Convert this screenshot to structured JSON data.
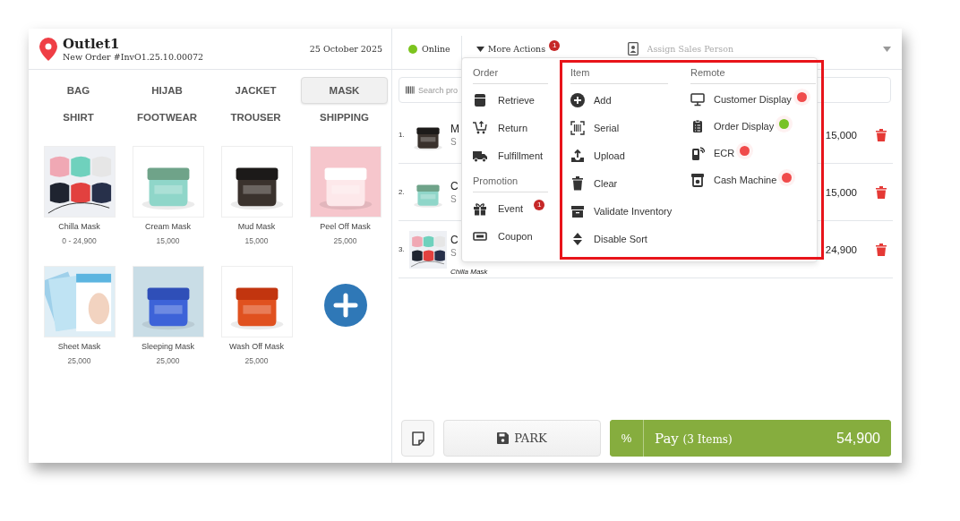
{
  "header": {
    "outlet": "Outlet1",
    "order_number": "New Order #InvO1.25.10.00072",
    "date": "25 October 2025"
  },
  "categories": [
    {
      "label": "BAG",
      "selected": false
    },
    {
      "label": "HIJAB",
      "selected": false
    },
    {
      "label": "JACKET",
      "selected": false
    },
    {
      "label": "MASK",
      "selected": true
    },
    {
      "label": "SHIRT",
      "selected": false
    },
    {
      "label": "FOOTWEAR",
      "selected": false
    },
    {
      "label": "TROUSER",
      "selected": false
    },
    {
      "label": "SHIPPING",
      "selected": false
    }
  ],
  "products": [
    {
      "name": "Chilla Mask",
      "price": "0 - 24,900"
    },
    {
      "name": "Cream Mask",
      "price": "15,000"
    },
    {
      "name": "Mud Mask",
      "price": "15,000"
    },
    {
      "name": "Peel Off Mask",
      "price": "25,000"
    },
    {
      "name": "Sheet Mask",
      "price": "25,000"
    },
    {
      "name": "Sleeping Mask",
      "price": "25,000"
    },
    {
      "name": "Wash Off Mask",
      "price": "25,000"
    }
  ],
  "toolbar": {
    "online": true,
    "status_label": "Online",
    "more_actions": "More Actions",
    "more_actions_badge": "1",
    "sales_person_placeholder": "Assign Sales Person"
  },
  "search": {
    "placeholder": "Search pro"
  },
  "cart": [
    {
      "number": "1.",
      "name": "M",
      "sub": "S",
      "price": "15,000"
    },
    {
      "number": "2.",
      "name": "C",
      "sub": "S",
      "price": "15,000"
    },
    {
      "number": "3.",
      "name": "C",
      "sub": "S",
      "note": "Chilla Mask",
      "price": "24,900"
    }
  ],
  "menu": {
    "columns": [
      {
        "groups": [
          {
            "heading": "Order",
            "items": [
              {
                "label": "Retrieve"
              },
              {
                "label": "Return"
              },
              {
                "label": "Fulfillment"
              }
            ]
          },
          {
            "heading": "Promotion",
            "items": [
              {
                "label": "Event",
                "badge": "1"
              },
              {
                "label": "Coupon"
              }
            ]
          }
        ]
      },
      {
        "highlighted": true,
        "groups": [
          {
            "heading": "Item",
            "items": [
              {
                "label": "Add"
              },
              {
                "label": "Serial"
              },
              {
                "label": "Upload"
              },
              {
                "label": "Clear"
              },
              {
                "label": "Validate Inventory"
              },
              {
                "label": "Disable Sort"
              }
            ]
          }
        ]
      },
      {
        "highlighted": true,
        "groups": [
          {
            "heading": "Remote",
            "items": [
              {
                "label": "Customer Display",
                "color": "#f04b4b"
              },
              {
                "label": "Order Display",
                "color": "#78c326"
              },
              {
                "label": "ECR",
                "color": "#f04b4b"
              },
              {
                "label": "Cash Machine",
                "color": "#f04b4b"
              }
            ]
          }
        ]
      }
    ]
  },
  "footer": {
    "park": "PARK",
    "discount": "%",
    "pay_label": "Pay",
    "pay_count": "(3 Items)",
    "pay_total": "54,900"
  }
}
